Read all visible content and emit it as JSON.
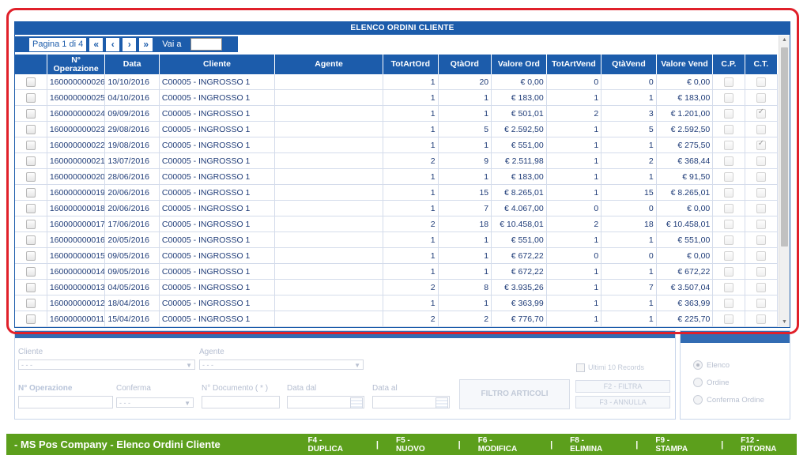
{
  "panel_title": "ELENCO ORDINI CLIENTE",
  "pager": {
    "page_label": "Pagina 1 di 4",
    "first": "«",
    "prev": "‹",
    "next": "›",
    "last": "»",
    "goto_label": "Vai a",
    "goto_value": ""
  },
  "columns": [
    "N° Operazione",
    "Data",
    "Cliente",
    "Agente",
    "TotArtOrd",
    "QtàOrd",
    "Valore Ord",
    "TotArtVend",
    "QtàVend",
    "Valore Vend",
    "C.P.",
    "C.T."
  ],
  "rows": [
    {
      "op": "160000000026",
      "data": "10/10/2016",
      "cliente": "C00005 - INGROSSO 1",
      "agente": "",
      "totart": "1",
      "qta": "20",
      "valore": "€ 0,00",
      "totvend": "0",
      "qtavend": "0",
      "valvend": "€ 0,00",
      "cp": false,
      "ct": false
    },
    {
      "op": "160000000025",
      "data": "04/10/2016",
      "cliente": "C00005 - INGROSSO 1",
      "agente": "",
      "totart": "1",
      "qta": "1",
      "valore": "€ 183,00",
      "totvend": "1",
      "qtavend": "1",
      "valvend": "€ 183,00",
      "cp": false,
      "ct": false
    },
    {
      "op": "160000000024",
      "data": "09/09/2016",
      "cliente": "C00005 - INGROSSO 1",
      "agente": "",
      "totart": "1",
      "qta": "1",
      "valore": "€ 501,01",
      "totvend": "2",
      "qtavend": "3",
      "valvend": "€ 1.201,00",
      "cp": false,
      "ct": true
    },
    {
      "op": "160000000023",
      "data": "29/08/2016",
      "cliente": "C00005 - INGROSSO 1",
      "agente": "",
      "totart": "1",
      "qta": "5",
      "valore": "€ 2.592,50",
      "totvend": "1",
      "qtavend": "5",
      "valvend": "€ 2.592,50",
      "cp": false,
      "ct": false
    },
    {
      "op": "160000000022",
      "data": "19/08/2016",
      "cliente": "C00005 - INGROSSO 1",
      "agente": "",
      "totart": "1",
      "qta": "1",
      "valore": "€ 551,00",
      "totvend": "1",
      "qtavend": "1",
      "valvend": "€ 275,50",
      "cp": false,
      "ct": true
    },
    {
      "op": "160000000021",
      "data": "13/07/2016",
      "cliente": "C00005 - INGROSSO 1",
      "agente": "",
      "totart": "2",
      "qta": "9",
      "valore": "€ 2.511,98",
      "totvend": "1",
      "qtavend": "2",
      "valvend": "€ 368,44",
      "cp": false,
      "ct": false
    },
    {
      "op": "160000000020",
      "data": "28/06/2016",
      "cliente": "C00005 - INGROSSO 1",
      "agente": "",
      "totart": "1",
      "qta": "1",
      "valore": "€ 183,00",
      "totvend": "1",
      "qtavend": "1",
      "valvend": "€ 91,50",
      "cp": false,
      "ct": false
    },
    {
      "op": "160000000019",
      "data": "20/06/2016",
      "cliente": "C00005 - INGROSSO 1",
      "agente": "",
      "totart": "1",
      "qta": "15",
      "valore": "€ 8.265,01",
      "totvend": "1",
      "qtavend": "15",
      "valvend": "€ 8.265,01",
      "cp": false,
      "ct": false
    },
    {
      "op": "160000000018",
      "data": "20/06/2016",
      "cliente": "C00005 - INGROSSO 1",
      "agente": "",
      "totart": "1",
      "qta": "7",
      "valore": "€ 4.067,00",
      "totvend": "0",
      "qtavend": "0",
      "valvend": "€ 0,00",
      "cp": false,
      "ct": false
    },
    {
      "op": "160000000017",
      "data": "17/06/2016",
      "cliente": "C00005 - INGROSSO 1",
      "agente": "",
      "totart": "2",
      "qta": "18",
      "valore": "€ 10.458,01",
      "totvend": "2",
      "qtavend": "18",
      "valvend": "€ 10.458,01",
      "cp": false,
      "ct": false
    },
    {
      "op": "160000000016",
      "data": "20/05/2016",
      "cliente": "C00005 - INGROSSO 1",
      "agente": "",
      "totart": "1",
      "qta": "1",
      "valore": "€ 551,00",
      "totvend": "1",
      "qtavend": "1",
      "valvend": "€ 551,00",
      "cp": false,
      "ct": false
    },
    {
      "op": "160000000015",
      "data": "09/05/2016",
      "cliente": "C00005 - INGROSSO 1",
      "agente": "",
      "totart": "1",
      "qta": "1",
      "valore": "€ 672,22",
      "totvend": "0",
      "qtavend": "0",
      "valvend": "€ 0,00",
      "cp": false,
      "ct": false
    },
    {
      "op": "160000000014",
      "data": "09/05/2016",
      "cliente": "C00005 - INGROSSO 1",
      "agente": "",
      "totart": "1",
      "qta": "1",
      "valore": "€ 672,22",
      "totvend": "1",
      "qtavend": "1",
      "valvend": "€ 672,22",
      "cp": false,
      "ct": false
    },
    {
      "op": "160000000013",
      "data": "04/05/2016",
      "cliente": "C00005 - INGROSSO 1",
      "agente": "",
      "totart": "2",
      "qta": "8",
      "valore": "€ 3.935,26",
      "totvend": "1",
      "qtavend": "7",
      "valvend": "€ 3.507,04",
      "cp": false,
      "ct": false
    },
    {
      "op": "160000000012",
      "data": "18/04/2016",
      "cliente": "C00005 - INGROSSO 1",
      "agente": "",
      "totart": "1",
      "qta": "1",
      "valore": "€ 363,99",
      "totvend": "1",
      "qtavend": "1",
      "valvend": "€ 363,99",
      "cp": false,
      "ct": false
    },
    {
      "op": "160000000011",
      "data": "15/04/2016",
      "cliente": "C00005 - INGROSSO 1",
      "agente": "",
      "totart": "2",
      "qta": "2",
      "valore": "€ 776,70",
      "totvend": "1",
      "qtavend": "1",
      "valvend": "€ 225,70",
      "cp": false,
      "ct": false
    }
  ],
  "filters": {
    "cliente_label": "Cliente",
    "cliente_value": "- - -",
    "agente_label": "Agente",
    "agente_value": "- - -",
    "operazione_label": "N° Operazione",
    "conferma_label": "Conferma",
    "conferma_value": "- - -",
    "documento_label": "N° Documento ( * )",
    "data_dal_label": "Data dal",
    "data_al_label": "Data al",
    "filtro_articoli": "FILTRO ARTICOLI",
    "ultimi_label": "Ultimi 10 Records",
    "filtra_btn": "F2 - FILTRA",
    "annulla_btn": "F3 - ANNULLA"
  },
  "sort": {
    "options": [
      "Elenco",
      "Ordine",
      "Conferma Ordine"
    ],
    "selected": 0
  },
  "bottombar": {
    "title": "- MS Pos Company - Elenco Ordini Cliente",
    "keys": [
      "F4 - DUPLICA",
      "F5 - NUOVO",
      "F6 - MODIFICA",
      "F8 - ELIMINA",
      "F9 - STAMPA",
      "F12 - RITORNA"
    ],
    "separator": "|"
  },
  "colors": {
    "header_blue": "#1c5cab",
    "bottom_green": "#5c9f1c",
    "highlight_red": "#e0202a"
  }
}
